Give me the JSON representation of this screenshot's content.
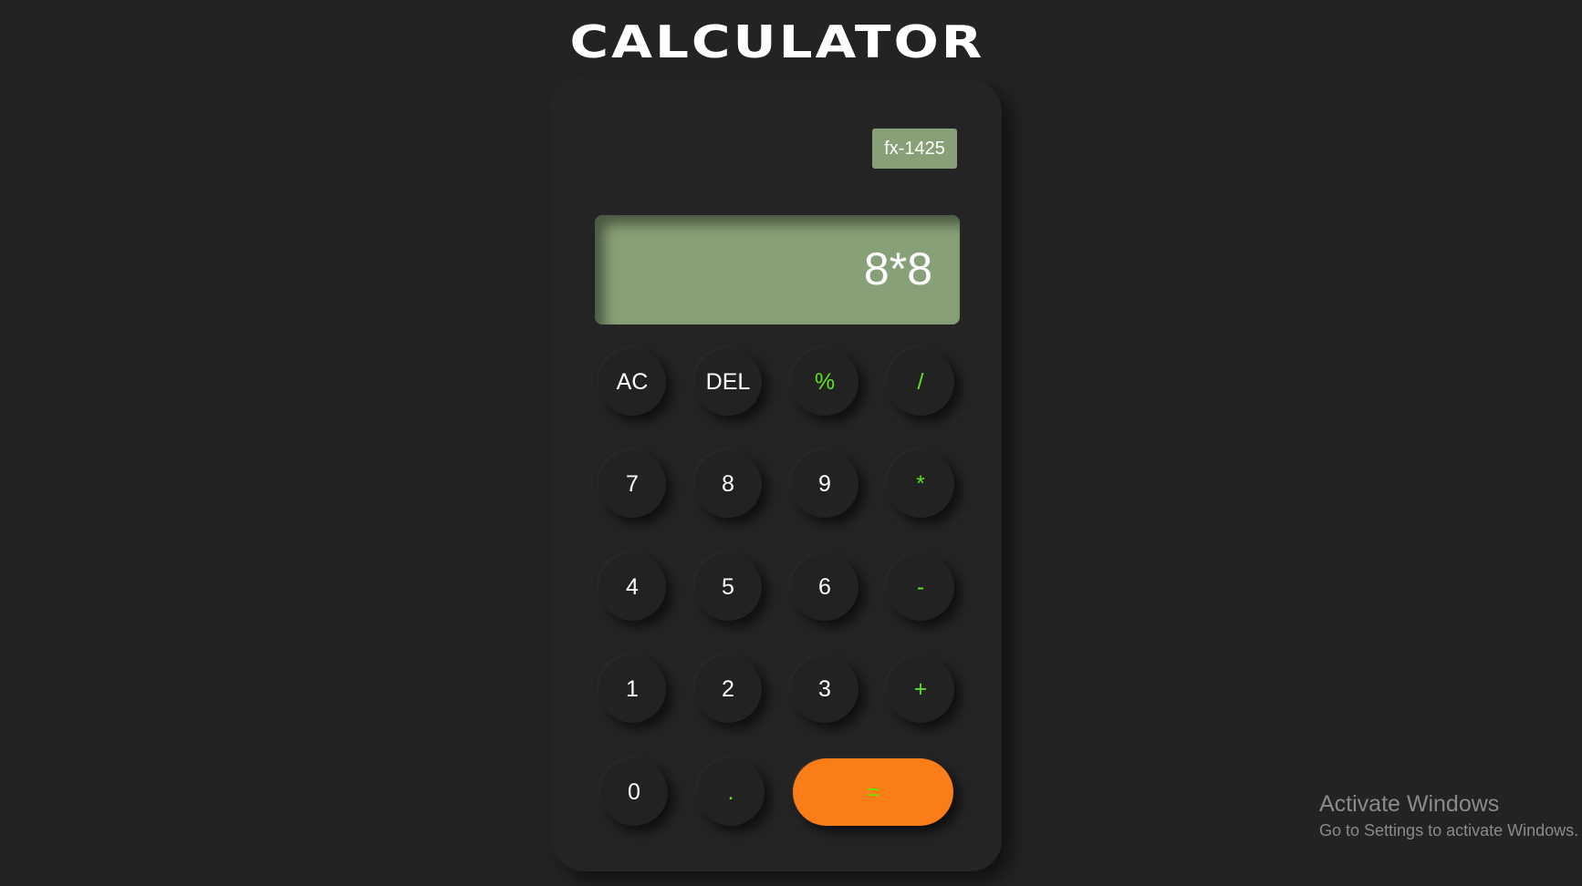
{
  "app": {
    "title": "CALCULATOR"
  },
  "calculator": {
    "model": "fx-1425",
    "display": "8*8",
    "colors": {
      "background": "#232323",
      "body": "#242424",
      "display": "#87a077",
      "operator_text": "#5fe21f",
      "equals_button": "#fb7d17"
    },
    "keys": {
      "ac": "AC",
      "del": "DEL",
      "percent": "%",
      "divide": "/",
      "seven": "7",
      "eight": "8",
      "nine": "9",
      "multiply": "*",
      "four": "4",
      "five": "5",
      "six": "6",
      "minus": "-",
      "one": "1",
      "two": "2",
      "three": "3",
      "plus": "+",
      "zero": "0",
      "decimal": ".",
      "equals": "="
    }
  },
  "watermark": {
    "title": "Activate Windows",
    "subtitle": "Go to Settings to activate Windows."
  }
}
